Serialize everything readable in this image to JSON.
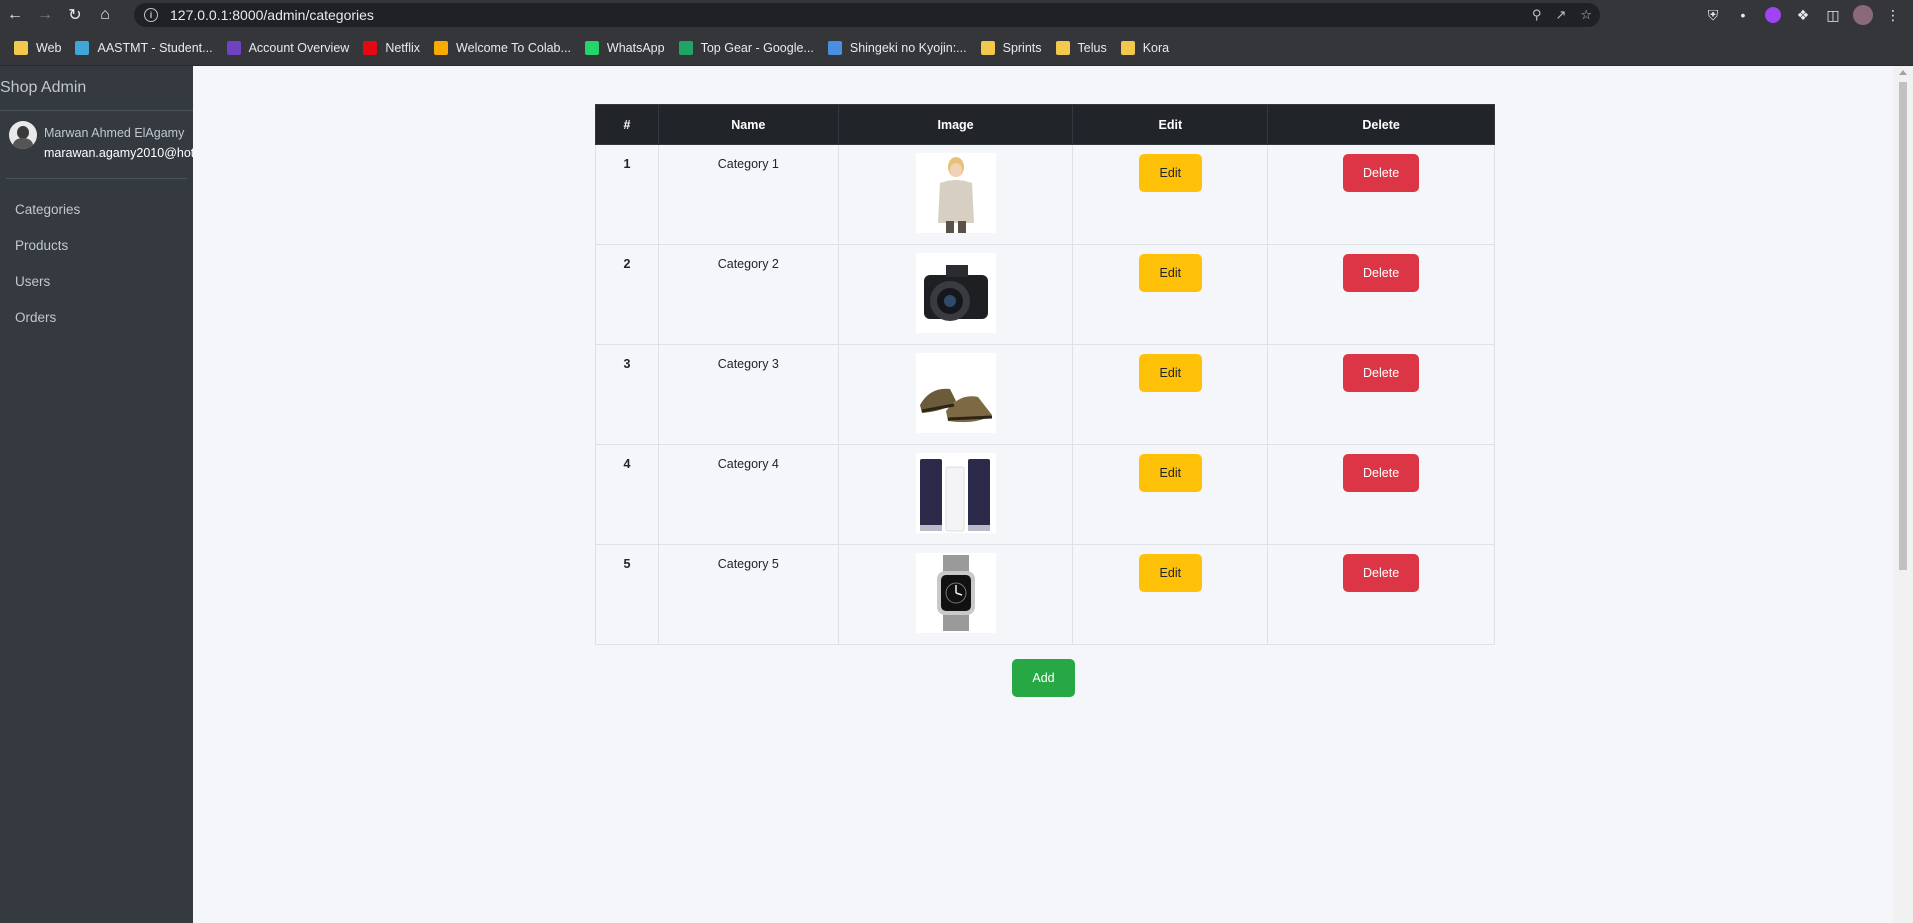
{
  "browser": {
    "url": "127.0.0.1:8000/admin/categories",
    "bookmarks": [
      {
        "label": "Web",
        "color": "#f2c94c"
      },
      {
        "label": "AASTMT - Student...",
        "color": "#3ea7d8"
      },
      {
        "label": "Account Overview",
        "color": "#6f42c1"
      },
      {
        "label": "Netflix",
        "color": "#e50914"
      },
      {
        "label": "Welcome To Colab...",
        "color": "#f9ab00"
      },
      {
        "label": "WhatsApp",
        "color": "#25d366"
      },
      {
        "label": "Top Gear - Google...",
        "color": "#1fa463"
      },
      {
        "label": "Shingeki no Kyojin:...",
        "color": "#4a90e2"
      },
      {
        "label": "Sprints",
        "color": "#f2c94c"
      },
      {
        "label": "Telus",
        "color": "#f2c94c"
      },
      {
        "label": "Kora",
        "color": "#f2c94c"
      }
    ]
  },
  "sidebar": {
    "brand": "Shop Admin",
    "user_name": "Marwan Ahmed ElAgamy",
    "user_email": "marawan.agamy2010@hot",
    "items": [
      {
        "label": "Categories"
      },
      {
        "label": "Products"
      },
      {
        "label": "Users"
      },
      {
        "label": "Orders"
      }
    ]
  },
  "table": {
    "headers": [
      "#",
      "Name",
      "Image",
      "Edit",
      "Delete"
    ],
    "rows": [
      {
        "num": "1",
        "name": "Category 1",
        "image": "woman-sweater",
        "edit": "Edit",
        "delete": "Delete"
      },
      {
        "num": "2",
        "name": "Category 2",
        "image": "camera",
        "edit": "Edit",
        "delete": "Delete"
      },
      {
        "num": "3",
        "name": "Category 3",
        "image": "shoes",
        "edit": "Edit",
        "delete": "Delete"
      },
      {
        "num": "4",
        "name": "Category 4",
        "image": "cosmetics-tubes",
        "edit": "Edit",
        "delete": "Delete"
      },
      {
        "num": "5",
        "name": "Category 5",
        "image": "smartwatch",
        "edit": "Edit",
        "delete": "Delete"
      }
    ]
  },
  "add_label": "Add",
  "colors": {
    "sidebar": "#343a40",
    "edit": "#ffc107",
    "delete": "#dc3545",
    "add": "#28a745",
    "table_head": "#212529"
  }
}
